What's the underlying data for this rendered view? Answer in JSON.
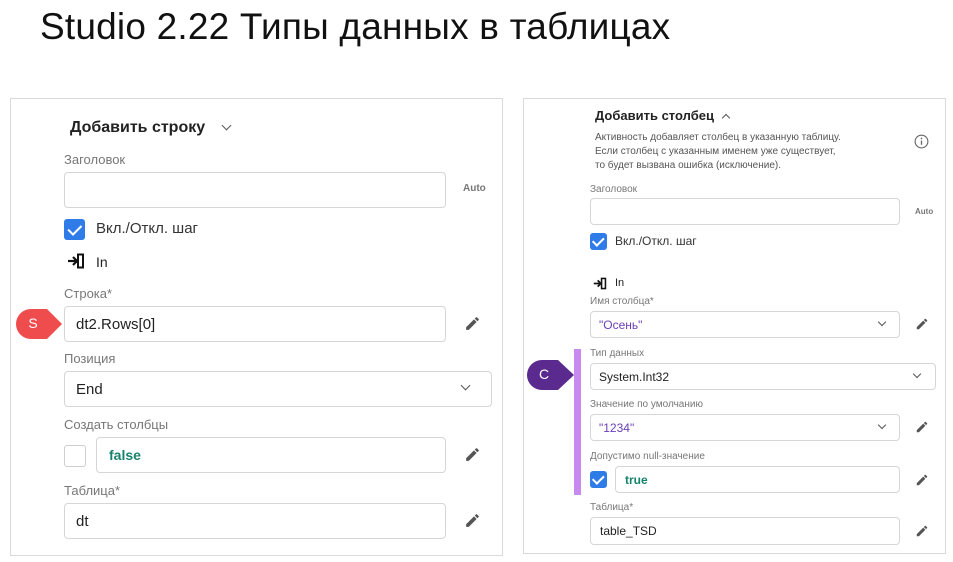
{
  "slide_title": "Studio 2.22 Типы данных в таблицах",
  "left": {
    "header": "Добавить строку",
    "title_label": "Заголовок",
    "title_value": "",
    "auto": "Auto",
    "step_toggle_label": "Вкл./Откл. шаг",
    "in_label": "In",
    "row_label": "Строка*",
    "row_value": "dt2.Rows[0]",
    "row_badge": "S",
    "position_label": "Позиция",
    "position_value": "End",
    "create_columns_label": "Создать столбцы",
    "create_columns_value": "false",
    "table_label": "Таблица*",
    "table_value": "dt"
  },
  "right": {
    "header": "Добавить столбец",
    "description": [
      "Активность добавляет столбец в указанную таблицу.",
      "Если столбец с указанным именем уже существует,",
      "то будет вызвана ошибка (исключение)."
    ],
    "title_label": "Заголовок",
    "title_value": "",
    "auto": "Auto",
    "step_toggle_label": "Вкл./Откл. шаг",
    "in_label": "In",
    "column_name_label": "Имя столбца*",
    "column_name_value": "\"Осень\"",
    "data_type_label": "Тип данных",
    "data_type_value": "System.Int32",
    "data_type_badge": "C",
    "default_value_label": "Значение по умолчанию",
    "default_value_value": "\"1234\"",
    "nullable_label": "Допустимо null-значение",
    "nullable_value": "true",
    "table_label": "Таблица*",
    "table_value": "table_TSD"
  },
  "colors": {
    "checkbox_blue": "#2f7be8",
    "badge_red": "#ef4d4d",
    "badge_purple": "#5b2a8f",
    "highlight_bar": "#c98af0",
    "bool_green": "#16836b",
    "string_purple": "#6a3fb5"
  },
  "icons": [
    "chevron-down-icon",
    "chevron-up-icon",
    "check-icon",
    "in-arrow-icon",
    "pencil-icon",
    "info-icon"
  ]
}
